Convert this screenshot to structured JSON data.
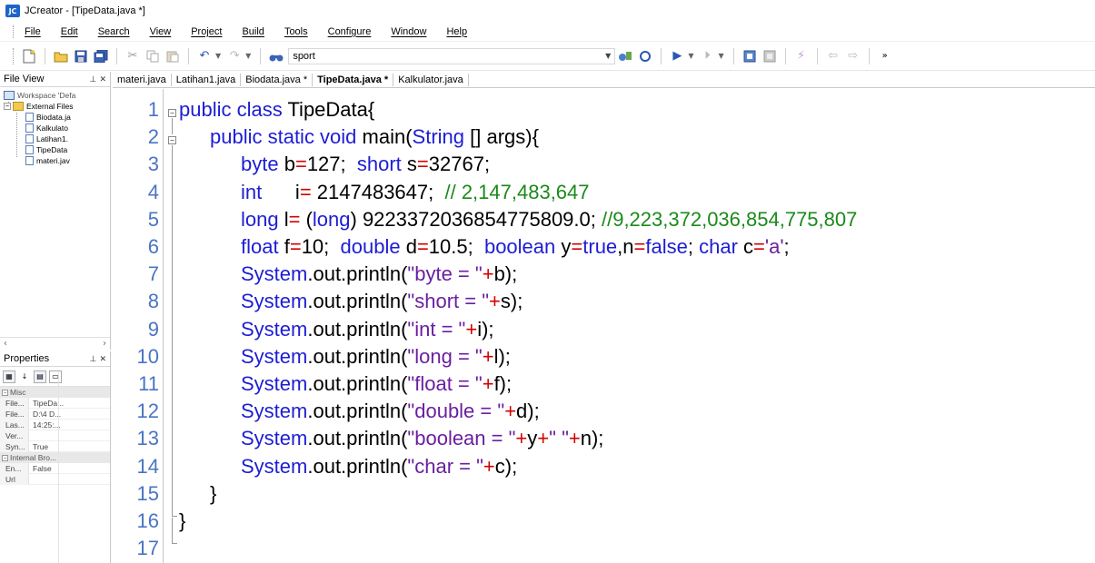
{
  "window": {
    "app_badge": "JC",
    "title": "JCreator - [TipeData.java *]"
  },
  "menu": {
    "items": [
      "File",
      "Edit",
      "Search",
      "View",
      "Project",
      "Build",
      "Tools",
      "Configure",
      "Window",
      "Help"
    ]
  },
  "toolbar": {
    "search_value": "sport",
    "icons": [
      "new-file-icon",
      "open-folder-icon",
      "save-icon",
      "save-all-icon",
      "cut-icon",
      "copy-icon",
      "paste-icon",
      "undo-icon",
      "redo-icon",
      "find-icon",
      "search-dropdown-icon",
      "find-replace-icon",
      "class-icon",
      "run-icon",
      "step-icon",
      "compile-icon",
      "build-icon",
      "wizard-icon",
      "back-icon",
      "forward-icon",
      "overflow-icon"
    ]
  },
  "file_view": {
    "title": "File View",
    "workspace": "Workspace 'Defa",
    "folder": "External Files",
    "files": [
      "Biodata.ja",
      "Kalkulato",
      "Latihan1.",
      "TipeData",
      "materi.jav"
    ]
  },
  "properties": {
    "title": "Properties",
    "categories": [
      {
        "name": "Misc",
        "rows": [
          {
            "key": "File...",
            "value": "TipeDa..."
          },
          {
            "key": "File...",
            "value": "D:\\4 D..."
          },
          {
            "key": "Las...",
            "value": "14:25:..."
          },
          {
            "key": "Ver...",
            "value": ""
          },
          {
            "key": "Syn...",
            "value": "True"
          }
        ]
      },
      {
        "name": "Internal Bro...",
        "rows": [
          {
            "key": "En...",
            "value": "False"
          },
          {
            "key": "Url",
            "value": ""
          }
        ]
      }
    ]
  },
  "tabs": [
    {
      "label": "materi.java",
      "active": false
    },
    {
      "label": "Latihan1.java",
      "active": false
    },
    {
      "label": "Biodata.java *",
      "active": false
    },
    {
      "label": "TipeData.java *",
      "active": true
    },
    {
      "label": "Kalkulator.java",
      "active": false
    }
  ],
  "editor": {
    "line_numbers": [
      "1",
      "2",
      "3",
      "4",
      "5",
      "6",
      "7",
      "8",
      "9",
      "10",
      "11",
      "12",
      "13",
      "14",
      "15",
      "16",
      "17"
    ],
    "lines": [
      [
        [
          "kw",
          "public class "
        ],
        [
          "",
          "TipeData{"
        ]
      ],
      [
        [
          "kw",
          "public static void "
        ],
        [
          "",
          "main("
        ],
        [
          "kw",
          "String"
        ],
        [
          "",
          " [] args){"
        ]
      ],
      [
        [
          "kw",
          "byte"
        ],
        [
          "",
          " b"
        ],
        [
          "op",
          "="
        ],
        [
          "",
          "127;  "
        ],
        [
          "kw",
          "short"
        ],
        [
          "",
          " s"
        ],
        [
          "op",
          "="
        ],
        [
          "",
          "32767;"
        ]
      ],
      [
        [
          "kw",
          "int"
        ],
        [
          "",
          "      i"
        ],
        [
          "op",
          "="
        ],
        [
          "",
          " 2147483647;  "
        ],
        [
          "cm",
          "// 2,147,483,647"
        ]
      ],
      [
        [
          "kw",
          "long"
        ],
        [
          "",
          " l"
        ],
        [
          "op",
          "="
        ],
        [
          "",
          " ("
        ],
        [
          "kw",
          "long"
        ],
        [
          "",
          ") 9223372036854775809.0; "
        ],
        [
          "cm",
          "//9,223,372,036,854,775,807"
        ]
      ],
      [
        [
          "kw",
          "float"
        ],
        [
          "",
          " f"
        ],
        [
          "op",
          "="
        ],
        [
          "",
          "10;  "
        ],
        [
          "kw",
          "double"
        ],
        [
          "",
          " d"
        ],
        [
          "op",
          "="
        ],
        [
          "",
          "10.5;  "
        ],
        [
          "kw",
          "boolean"
        ],
        [
          "",
          " y"
        ],
        [
          "op",
          "="
        ],
        [
          "kw",
          "true"
        ],
        [
          "",
          ",n"
        ],
        [
          "op",
          "="
        ],
        [
          "kw",
          "false"
        ],
        [
          "",
          "; "
        ],
        [
          "kw",
          "char"
        ],
        [
          "",
          " c"
        ],
        [
          "op",
          "="
        ],
        [
          "str",
          "'a'"
        ],
        [
          "",
          ";"
        ]
      ],
      [
        [
          "kw",
          "System"
        ],
        [
          "",
          ".out.println("
        ],
        [
          "str",
          "\"byte = \""
        ],
        [
          "op",
          "+"
        ],
        [
          "",
          "b);"
        ]
      ],
      [
        [
          "kw",
          "System"
        ],
        [
          "",
          ".out.println("
        ],
        [
          "str",
          "\"short = \""
        ],
        [
          "op",
          "+"
        ],
        [
          "",
          "s);"
        ]
      ],
      [
        [
          "kw",
          "System"
        ],
        [
          "",
          ".out.println("
        ],
        [
          "str",
          "\"int = \""
        ],
        [
          "op",
          "+"
        ],
        [
          "",
          "i);"
        ]
      ],
      [
        [
          "kw",
          "System"
        ],
        [
          "",
          ".out.println("
        ],
        [
          "str",
          "\"long = \""
        ],
        [
          "op",
          "+"
        ],
        [
          "",
          "l);"
        ]
      ],
      [
        [
          "kw",
          "System"
        ],
        [
          "",
          ".out.println("
        ],
        [
          "str",
          "\"float = \""
        ],
        [
          "op",
          "+"
        ],
        [
          "",
          "f);"
        ]
      ],
      [
        [
          "kw",
          "System"
        ],
        [
          "",
          ".out.println("
        ],
        [
          "str",
          "\"double = \""
        ],
        [
          "op",
          "+"
        ],
        [
          "",
          "d);"
        ]
      ],
      [
        [
          "kw",
          "System"
        ],
        [
          "",
          ".out.println("
        ],
        [
          "str",
          "\"boolean = \""
        ],
        [
          "op",
          "+"
        ],
        [
          "",
          "y"
        ],
        [
          "op",
          "+"
        ],
        [
          "str",
          "\" \""
        ],
        [
          "op",
          "+"
        ],
        [
          "",
          "n);"
        ]
      ],
      [
        [
          "kw",
          "System"
        ],
        [
          "",
          ".out.println("
        ],
        [
          "str",
          "\"char = \""
        ],
        [
          "op",
          "+"
        ],
        [
          "",
          "c);"
        ]
      ],
      [
        [
          "",
          "}"
        ]
      ],
      [
        [
          "",
          "}"
        ]
      ],
      []
    ],
    "colors": {
      "keyword": "#1d1dd4",
      "string": "#6a1fa0",
      "operator": "#d40000",
      "comment": "#1a8a1a",
      "line_number": "#4a74c4"
    }
  }
}
